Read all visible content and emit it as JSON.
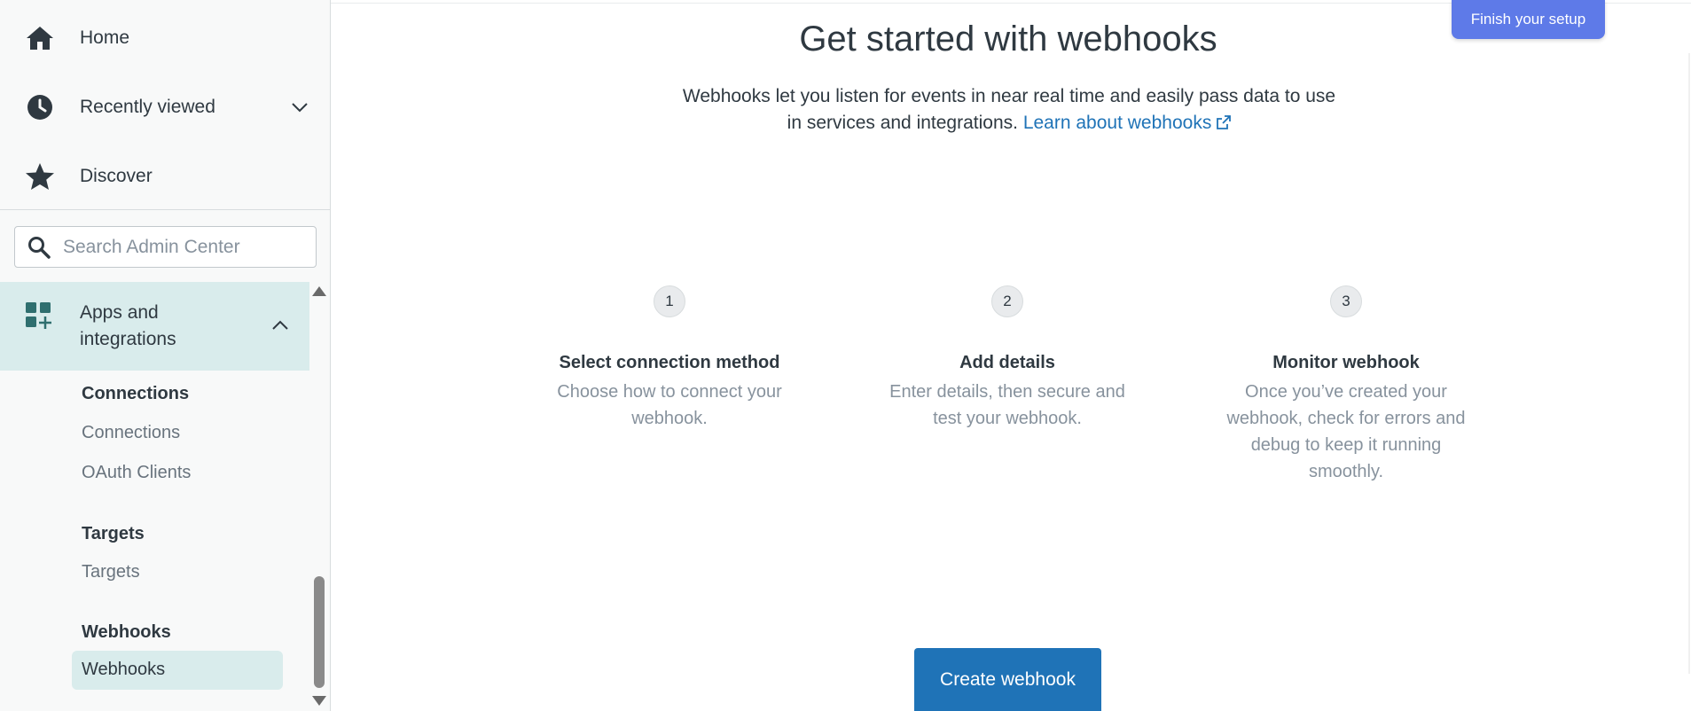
{
  "sidebar": {
    "home_label": "Home",
    "recently_viewed_label": "Recently viewed",
    "discover_label": "Discover",
    "search_placeholder": "Search Admin Center",
    "apps_label": "Apps and integrations",
    "groups": {
      "connections_title": "Connections",
      "connections_link": "Connections",
      "oauth_link": "OAuth Clients",
      "targets_title": "Targets",
      "targets_link": "Targets",
      "webhooks_title": "Webhooks",
      "webhooks_link": "Webhooks"
    }
  },
  "main": {
    "finish_setup_label": "Finish your setup",
    "title": "Get started with webhooks",
    "intro": "Webhooks let you listen for events in near real time and easily pass data to use in services and integrations.",
    "learn_link": "Learn about webhooks",
    "steps": [
      {
        "number": "1",
        "title": "Select connection method",
        "description": "Choose how to connect your webhook."
      },
      {
        "number": "2",
        "title": "Add details",
        "description": "Enter details, then secure and test your webhook."
      },
      {
        "number": "3",
        "title": "Monitor webhook",
        "description": "Once you’ve created your webhook, check for errors and debug to keep it running smoothly."
      }
    ],
    "create_button_label": "Create webhook"
  },
  "colors": {
    "accent": "#1f73b7",
    "finish_button": "#5e7ae8",
    "sidebar_active": "#d9ecec",
    "sidebar_bg": "#f8f9f9"
  },
  "icons": {
    "home": "home-icon",
    "recent": "clock-icon",
    "discover": "star-icon",
    "search": "search-icon",
    "apps": "apps-grid-icon",
    "external": "external-link-icon"
  }
}
